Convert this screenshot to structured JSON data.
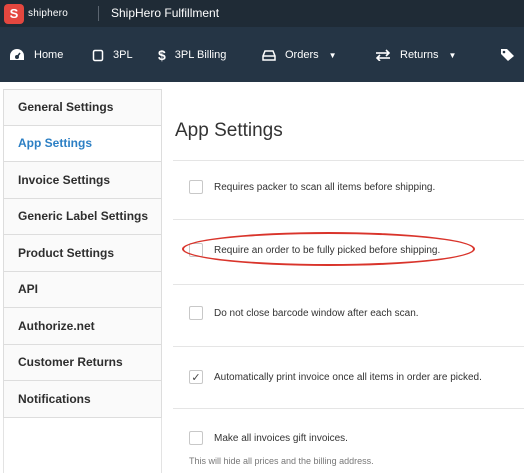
{
  "brand": {
    "logo_text": "shiphero",
    "app_title": "ShipHero Fulfillment"
  },
  "nav": {
    "items": [
      {
        "label": "Home",
        "icon": "dashboard-icon"
      },
      {
        "label": "3PL",
        "icon": "cube-icon"
      },
      {
        "label": "3PL Billing",
        "icon": "dollar-icon"
      },
      {
        "label": "Orders",
        "icon": "inbox-icon",
        "caret": "▼"
      },
      {
        "label": "Returns",
        "icon": "exchange-icon",
        "caret": "▼"
      },
      {
        "label": "",
        "icon": "tags-icon"
      }
    ]
  },
  "sidebar": {
    "items": [
      {
        "label": "General Settings",
        "active": false
      },
      {
        "label": "App Settings",
        "active": true
      },
      {
        "label": "Invoice Settings",
        "active": false
      },
      {
        "label": "Generic Label Settings",
        "active": false
      },
      {
        "label": "Product Settings",
        "active": false
      },
      {
        "label": "API",
        "active": false
      },
      {
        "label": "Authorize.net",
        "active": false
      },
      {
        "label": "Customer Returns",
        "active": false
      },
      {
        "label": "Notifications",
        "active": false
      }
    ]
  },
  "main": {
    "title": "App Settings",
    "settings": [
      {
        "label": "Requires packer to scan all items before shipping.",
        "checked": false
      },
      {
        "label": "Require an order to be fully picked before shipping.",
        "checked": false
      },
      {
        "label": "Do not close barcode window after each scan.",
        "checked": false
      },
      {
        "label": "Automatically print invoice once all items in order are picked.",
        "checked": true,
        "check_mark": "✓"
      },
      {
        "label": "Make all invoices gift invoices.",
        "checked": false,
        "helper": "This will hide all prices and the billing address."
      }
    ]
  },
  "colors": {
    "brandbar": "#1f2b36",
    "navbar": "#253545",
    "accent": "#2c7fc4",
    "annotation": "#d9342b",
    "logo": "#e4473f"
  }
}
